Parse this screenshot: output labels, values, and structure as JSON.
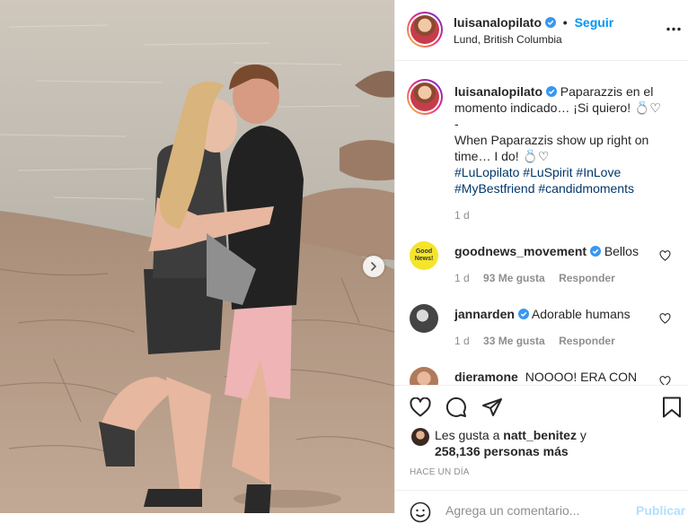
{
  "post": {
    "author": {
      "username": "luisanalopilato",
      "verified": true,
      "follow_label": "Seguir",
      "location": "Lund, British Columbia"
    },
    "more_icon": "more-horizontal-icon",
    "caption": {
      "line1": "Paparazzis en el",
      "line2": "momento indicado… ¡Si quiero! 💍♡",
      "line3": "-",
      "line4": "When Paparazzis show up right on",
      "line5": "time… I do! 💍♡",
      "hashtags_line1": "#LuLopilato #LuSpirit #InLove",
      "hashtags_line2": "#MyBestfriend #candidmoments",
      "time": "1 d"
    },
    "comments": [
      {
        "username": "goodnews_movement",
        "verified": true,
        "text": "Bellos",
        "time": "1 d",
        "likes": "93 Me gusta",
        "reply": "Responder",
        "avatar_text": "Good News!"
      },
      {
        "username": "jannarden",
        "verified": true,
        "text": "Adorable humans",
        "time": "1 d",
        "likes": "33 Me gusta",
        "reply": "Responder"
      },
      {
        "username": "dieramone",
        "verified": false,
        "text": "NOOOO! ERA CON"
      }
    ],
    "actions": {
      "like_icon": "heart-icon",
      "comment_icon": "comment-icon",
      "share_icon": "paper-plane-icon",
      "save_icon": "bookmark-icon"
    },
    "likes": {
      "prefix": "Les gusta a",
      "user": "natt_benitez",
      "suffix": "y",
      "count": "258,136 personas más"
    },
    "time_ago": "HACE UN DÍA",
    "add_comment": {
      "placeholder": "Agrega un comentario...",
      "publish_label": "Publicar"
    },
    "colors": {
      "link_blue": "#0095f6",
      "hashtag": "#00376b",
      "muted": "#8e8e8e",
      "verified": "#3897f0"
    }
  }
}
